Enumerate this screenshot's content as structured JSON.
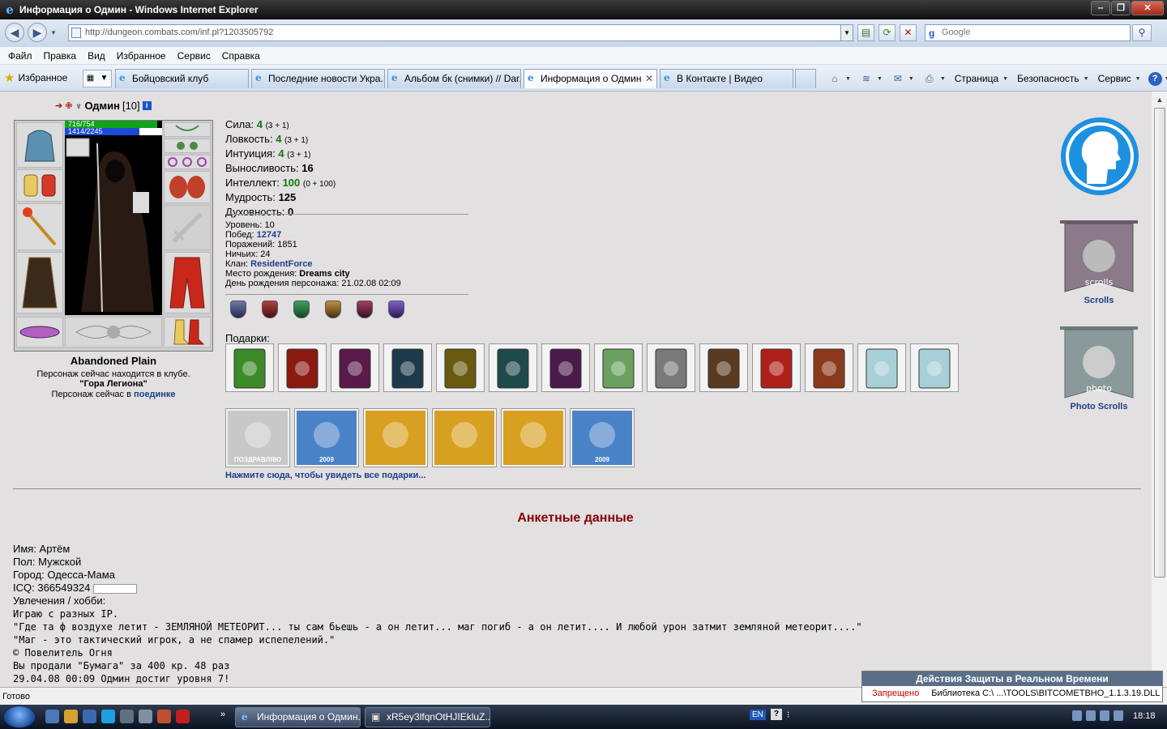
{
  "window": {
    "title": "Информация о Одмин - Windows Internet Explorer",
    "btn_min": "‒",
    "btn_max": "❐",
    "btn_close": "✕"
  },
  "address": {
    "url": "http://dungeon.combats.com/inf.pl?1203505792",
    "search_placeholder": "Google"
  },
  "menu": [
    "Файл",
    "Правка",
    "Вид",
    "Избранное",
    "Сервис",
    "Справка"
  ],
  "favorites_label": "Избранное",
  "tabs": [
    {
      "label": "Бойцовский клуб"
    },
    {
      "label": "Последние новости Укра..."
    },
    {
      "label": "Альбом бк (снимки) // Dar..."
    },
    {
      "label": "Информация о Одмин"
    },
    {
      "label": "В Контакте | Видео"
    }
  ],
  "command_bar": {
    "page": "Страница",
    "safety": "Безопасность",
    "tools": "Сервис"
  },
  "character": {
    "name": "Одмин",
    "level": "[10]",
    "hp": "716/754",
    "mana": "1414/2245",
    "hp_fraction": 0.95,
    "mana_fraction": 0.63
  },
  "location": {
    "name": "Abandoned Plain",
    "club_line": "Персонаж сейчас находится в клубе.",
    "club_room": "\"Гора Легиона\"",
    "fight_prefix": "Персонаж сейчас в",
    "fight_link": "поединке"
  },
  "stats": [
    {
      "label": "Сила:",
      "value": "4",
      "extra": "(3 + 1)",
      "green": true
    },
    {
      "label": "Ловкость:",
      "value": "4",
      "extra": "(3 + 1)",
      "green": true
    },
    {
      "label": "Интуиция:",
      "value": "4",
      "extra": "(3 + 1)",
      "green": true
    },
    {
      "label": "Выносливость:",
      "value": "16",
      "extra": "",
      "green": false
    },
    {
      "label": "Интеллект:",
      "value": "100",
      "extra": "(0 + 100)",
      "green": true
    },
    {
      "label": "Мудрость:",
      "value": "125",
      "extra": "",
      "green": false
    },
    {
      "label": "Духовность:",
      "value": "0",
      "extra": "",
      "green": false
    }
  ],
  "info": {
    "level": "Уровень: 10",
    "wins_label": "Побед:",
    "wins": "12747",
    "losses": "Поражений: 1851",
    "draws": "Ничьих: 24",
    "clan_label": "Клан:",
    "clan": "ResidentForce",
    "birthplace_label": "Место рождения:",
    "birthplace": "Dreams city",
    "birthday": "День рождения персонажа: 21.02.08 02:09"
  },
  "gifts": {
    "label": "Подарки:",
    "link": "Нажмите сюда, чтобы увидеть все подарки...",
    "row1_colors": [
      "#3c8a2a",
      "#8a1a10",
      "#5a1a4a",
      "#1d3a4a",
      "#6a5a10",
      "#1d4a4a",
      "#4a1a4a",
      "#6aa060",
      "#7a7a7a",
      "#5a3a20",
      "#b0201a",
      "#8a3a1a",
      "#a8d0d8",
      "#a8d0d8"
    ],
    "row2": [
      {
        "color": "#c8c8c8",
        "text": "ПОЗДРАВЛЯЮ"
      },
      {
        "color": "#4a82c8",
        "text": "2009"
      },
      {
        "color": "#d8a020",
        "text": ""
      },
      {
        "color": "#d8a020",
        "text": ""
      },
      {
        "color": "#d8a020",
        "text": ""
      },
      {
        "color": "#4a82c8",
        "text": "2009"
      }
    ]
  },
  "right_panel": {
    "scrolls": "Scrolls",
    "photo_scrolls": "Photo Scrolls",
    "scroll_img_text": "scrolls",
    "photo_img_text": "photo"
  },
  "anket": {
    "title": "Анкетные данные",
    "name": "Имя: Артём",
    "sex": "Пол: Мужской",
    "city": "Город: Одесса-Мама",
    "icq": "ICQ: 366549324",
    "hobby_label": "Увлечения / хобби:",
    "lines": [
      "Играю с разных IP.",
      "\"Где та ф воздухе летит - ЗЕМЛЯНОЙ МЕТЕОРИТ... ты сам бьешь - а он летит... маг погиб - а он летит.... И любой урон затмит земляной метеорит....\"",
      "\"Маг - это тактический игрок, а не спамер испепелений.\"",
      "© Повелитель Огня",
      "Вы продали \"Бумага\" за 400 кр. 48 раз",
      "29.04.08 00:09 Одмин достиг уровня 7!"
    ]
  },
  "status": {
    "text": "Готово"
  },
  "popup": {
    "title": "Действия Защиты в Реальном Времени",
    "state": "Запрещено",
    "message": "Библиотека C:\\ ...\\TOOLS\\BITCOMETВНО_1.1.3.19.DLL"
  },
  "taskbar": {
    "items": [
      "Информация о Одмин...",
      "xR5ey3lfqnOtHJIEkluZ..."
    ],
    "lang": "EN",
    "clock": "18:18"
  }
}
